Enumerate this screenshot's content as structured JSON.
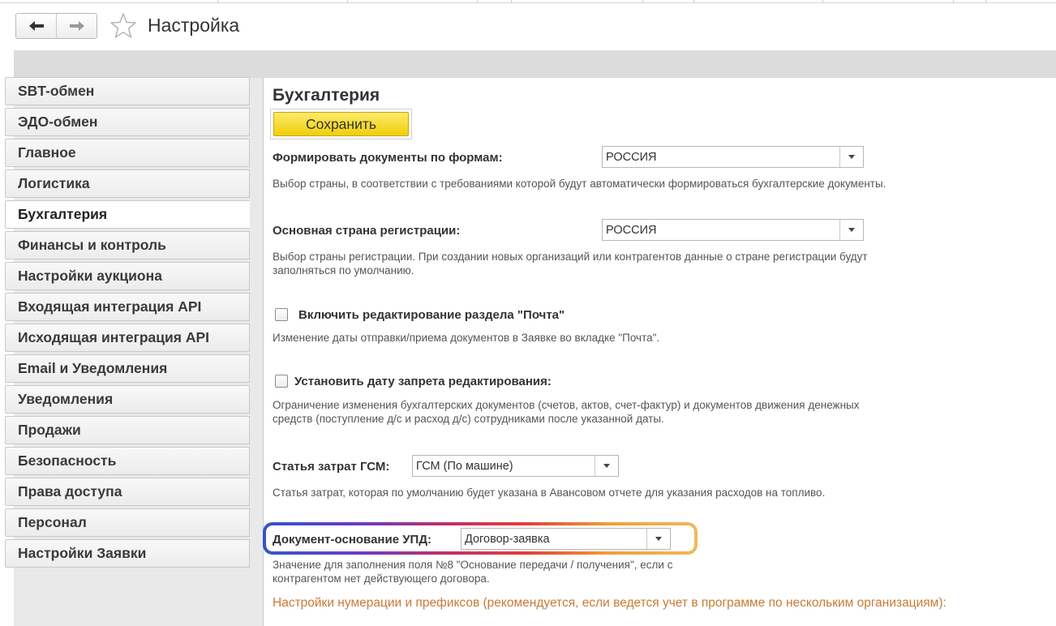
{
  "window": {
    "title": "Настройка",
    "back_icon": "arrow-left-icon",
    "forward_icon": "arrow-right-icon",
    "favorite_icon": "star-icon"
  },
  "sidebar": {
    "items": [
      {
        "label": "SBT-обмен"
      },
      {
        "label": "ЭДО-обмен"
      },
      {
        "label": "Главное"
      },
      {
        "label": "Логистика"
      },
      {
        "label": "Бухгалтерия",
        "active": true
      },
      {
        "label": "Финансы и контроль"
      },
      {
        "label": "Настройки аукциона"
      },
      {
        "label": "Входящая интеграция API"
      },
      {
        "label": "Исходящая интеграция API"
      },
      {
        "label": "Email и Уведомления"
      },
      {
        "label": "Уведомления"
      },
      {
        "label": "Продажи"
      },
      {
        "label": "Безопасность"
      },
      {
        "label": "Права доступа"
      },
      {
        "label": "Персонал"
      },
      {
        "label": "Настройки Заявки"
      }
    ]
  },
  "main": {
    "section_title": "Бухгалтерия",
    "save_label": "Сохранить",
    "forms": {
      "label": "Формировать документы по формам:",
      "value": "РОССИЯ",
      "hint": "Выбор страны, в соответствии с требованиями которой будут автоматически формироваться бухгалтерские документы."
    },
    "country": {
      "label": "Основная страна регистрации:",
      "value": "РОССИЯ",
      "hint_line1": "Выбор страны регистрации. При создании новых организаций или контрагентов данные о стране регистрации будут",
      "hint_line2": "заполняться по умолчанию."
    },
    "mail_edit": {
      "label": "Включить редактирование раздела \"Почта\"",
      "checked": false,
      "hint": "Изменение даты отправки/приема документов в Заявке во вкладке \"Почта\"."
    },
    "edit_lock": {
      "label": "Установить дату запрета редактирования:",
      "checked": false,
      "hint_line1": "Ограничение изменения бухгалтерских документов (счетов, актов, счет-фактур) и документов движения денежных",
      "hint_line2": "средств (поступление д/с и расход д/с) сотрудниками после указанной даты."
    },
    "fuel": {
      "label": "Статья затрат ГСМ:",
      "value": "ГСМ (По машине)",
      "hint": "Статья затрат, которая по умолчанию будет указана в Авансовом отчете для указания расходов на топливо."
    },
    "upd": {
      "label": "Документ-основание УПД:",
      "value": "Договор-заявка",
      "hint_line1": "Значение для заполнения поля №8 \"Основание передачи / получения\", если с",
      "hint_line2": "контрагентом нет действующего договора."
    },
    "numbering_note": "Настройки нумерации и префиксов (рекомендуется, если ведется учет в программе по нескольким организациям):"
  },
  "colors": {
    "save_button": "#f5d623",
    "note": "#c77b35",
    "highlight_start": "#3355cc",
    "highlight_end": "#f2b85a"
  }
}
